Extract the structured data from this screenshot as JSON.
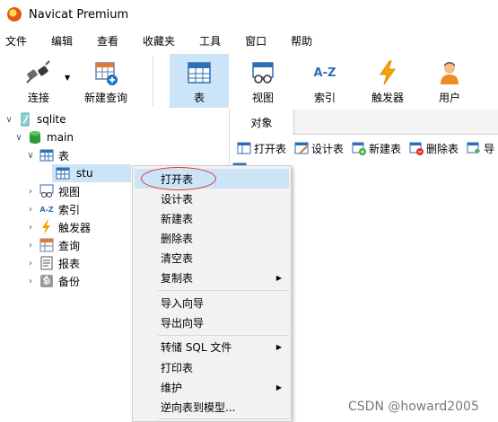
{
  "window": {
    "title": "Navicat Premium"
  },
  "menu": [
    "文件",
    "编辑",
    "查看",
    "收藏夹",
    "工具",
    "窗口",
    "帮助"
  ],
  "toolbar": {
    "connect": "连接",
    "new_query": "新建查询",
    "table": "表",
    "view": "视图",
    "index": "索引",
    "trigger": "触发器",
    "user": "用户",
    "index_icon_text": "A-Z"
  },
  "tree": {
    "connection": "sqlite",
    "database": "main",
    "tables_group": "表",
    "table_item": "stu",
    "views": "视图",
    "indexes": "索引",
    "indexes_icon_text": "A-Z",
    "triggers": "触发器",
    "queries": "查询",
    "reports": "报表",
    "backups": "备份"
  },
  "objects_pane": {
    "tab": "对象",
    "buttons": [
      "打开表",
      "设计表",
      "新建表",
      "删除表",
      "导"
    ]
  },
  "context_menu": {
    "open_table": "打开表",
    "design_table": "设计表",
    "new_table": "新建表",
    "delete_table": "删除表",
    "empty_table": "清空表",
    "copy_table": "复制表",
    "import_wizard": "导入向导",
    "export_wizard": "导出向导",
    "dump_sql": "转储 SQL 文件",
    "print_table": "打印表",
    "maintain": "维护",
    "reverse_model": "逆向表到模型...",
    "submenu_arrow": "▶"
  },
  "watermark": "CSDN @howard2005",
  "colors": {
    "selection": "#cce4f7",
    "annotation_circle": "#e0302b"
  }
}
